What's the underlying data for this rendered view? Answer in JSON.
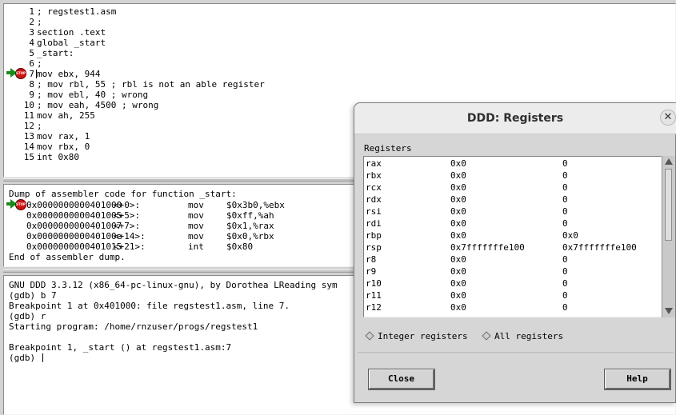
{
  "source": {
    "lines": [
      {
        "num": "1",
        "code": "; regstest1.asm"
      },
      {
        "num": "2",
        "code": ";"
      },
      {
        "num": "3",
        "code": "section .text"
      },
      {
        "num": "4",
        "code": "global _start"
      },
      {
        "num": "5",
        "code": "_start:"
      },
      {
        "num": "6",
        "code": ";"
      },
      {
        "num": "7",
        "code": "mov ebx, 944"
      },
      {
        "num": "8",
        "code": "; mov rbl, 55 ; rbl is not an able register"
      },
      {
        "num": "9",
        "code": "; mov ebl, 40 ; wrong"
      },
      {
        "num": "10",
        "code": "; mov eah, 4500 ; wrong"
      },
      {
        "num": "11",
        "code": "mov ah, 255"
      },
      {
        "num": "12",
        "code": ";"
      },
      {
        "num": "13",
        "code": "mov rax, 1"
      },
      {
        "num": "14",
        "code": "mov rbx, 0"
      },
      {
        "num": "15",
        "code": "int 0x80"
      }
    ],
    "breakpoint_badge": "STOP"
  },
  "assembly": {
    "header": "Dump of assembler code for function _start:",
    "rows": [
      {
        "addr": "0x0000000000401000",
        "offset": "<+0>:",
        "op": "mov",
        "args": "$0x3b0,%ebx"
      },
      {
        "addr": "0x0000000000401005",
        "offset": "<+5>:",
        "op": "mov",
        "args": "$0xff,%ah"
      },
      {
        "addr": "0x0000000000401007",
        "offset": "<+7>:",
        "op": "mov",
        "args": "$0x1,%rax"
      },
      {
        "addr": "0x000000000040100e",
        "offset": "<+14>:",
        "op": "mov",
        "args": "$0x0,%rbx"
      },
      {
        "addr": "0x0000000000401015",
        "offset": "<+21>:",
        "op": "int",
        "args": "$0x80"
      }
    ],
    "footer": "End of assembler dump."
  },
  "console": {
    "lines": [
      "GNU DDD 3.3.12 (x86_64-pc-linux-gnu), by Dorothea LReading sym",
      "(gdb) b 7",
      "Breakpoint 1 at 0x401000: file regstest1.asm, line 7.",
      "(gdb) r",
      "Starting program: /home/rnzuser/progs/regstest1",
      "",
      "Breakpoint 1, _start () at regstest1.asm:7",
      "(gdb) "
    ]
  },
  "registers_dialog": {
    "title": "DDD: Registers",
    "close_glyph": "✕",
    "list_label": "Registers",
    "registers": [
      {
        "name": "rax",
        "hex": "0x0",
        "natural": "0"
      },
      {
        "name": "rbx",
        "hex": "0x0",
        "natural": "0"
      },
      {
        "name": "rcx",
        "hex": "0x0",
        "natural": "0"
      },
      {
        "name": "rdx",
        "hex": "0x0",
        "natural": "0"
      },
      {
        "name": "rsi",
        "hex": "0x0",
        "natural": "0"
      },
      {
        "name": "rdi",
        "hex": "0x0",
        "natural": "0"
      },
      {
        "name": "rbp",
        "hex": "0x0",
        "natural": "0x0"
      },
      {
        "name": "rsp",
        "hex": "0x7fffffffe100",
        "natural": "0x7fffffffe100"
      },
      {
        "name": "r8",
        "hex": "0x0",
        "natural": "0"
      },
      {
        "name": "r9",
        "hex": "0x0",
        "natural": "0"
      },
      {
        "name": "r10",
        "hex": "0x0",
        "natural": "0"
      },
      {
        "name": "r11",
        "hex": "0x0",
        "natural": "0"
      },
      {
        "name": "r12",
        "hex": "0x0",
        "natural": "0"
      }
    ],
    "radio_integer": "Integer registers",
    "radio_all": "All registers",
    "close_button": "Close",
    "help_button": "Help"
  }
}
